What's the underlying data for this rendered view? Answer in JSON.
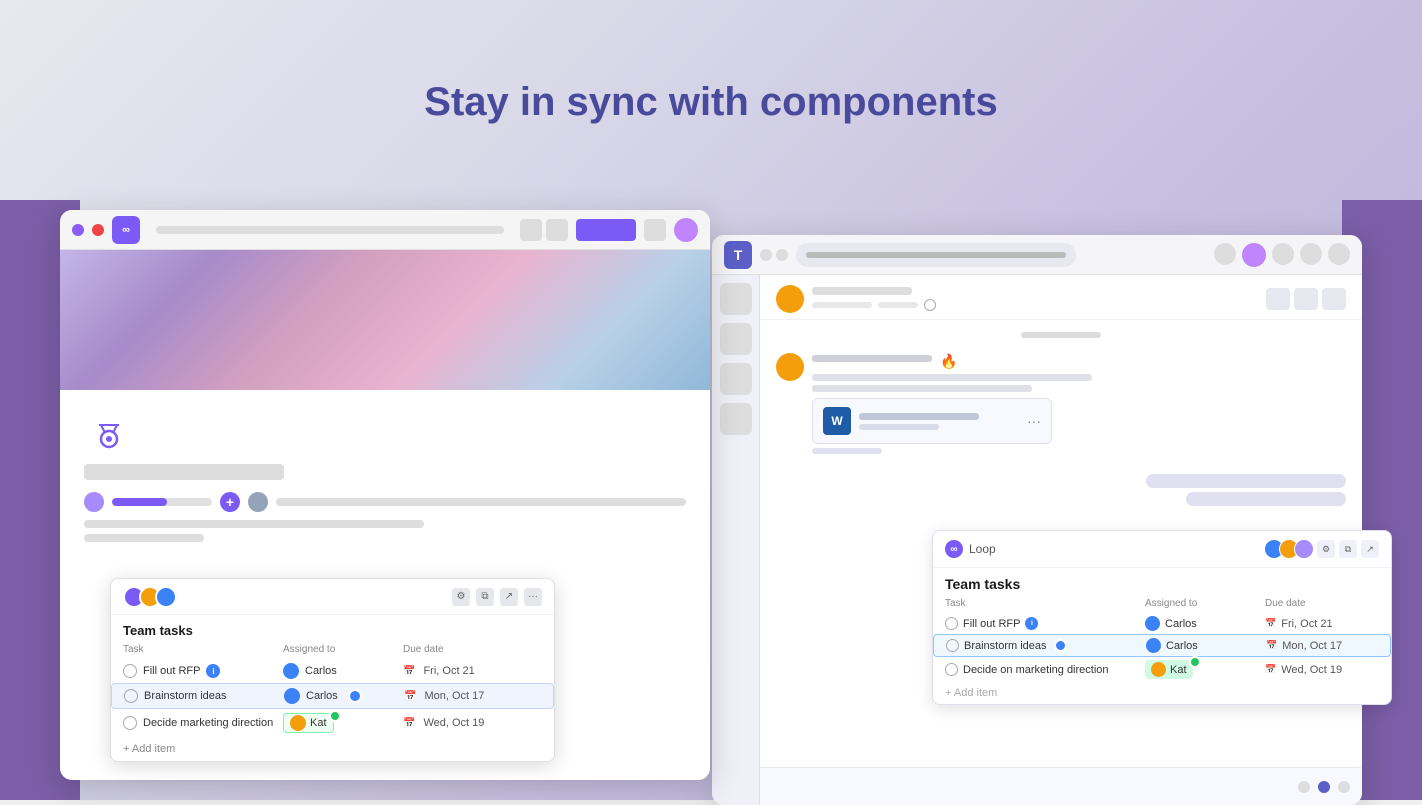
{
  "page": {
    "title": "Stay in sync with components",
    "background_color": "#e8e8f0"
  },
  "left_window": {
    "team_tasks_title": "Team tasks",
    "task_table": {
      "columns": [
        "Task",
        "Assigned to",
        "Due date"
      ],
      "rows": [
        {
          "task": "Fill out RFP",
          "assigned_to": "Carlos",
          "due_date": "Fri, Oct 21",
          "has_badge": true,
          "highlighted": false
        },
        {
          "task": "Brainstorm ideas",
          "assigned_to": "Carlos",
          "due_date": "Mon, Oct 17",
          "has_badge": false,
          "highlighted": true
        },
        {
          "task": "Decide marketing direction",
          "assigned_to": "Kat",
          "due_date": "Wed, Oct 19",
          "has_badge": false,
          "highlighted": false
        }
      ],
      "add_item_label": "+ Add item"
    }
  },
  "right_window": {
    "loop_card": {
      "app_name": "Loop",
      "title": "Team tasks",
      "columns": [
        "Task",
        "Assigned to",
        "Due date"
      ],
      "rows": [
        {
          "task": "Fill out RFP",
          "assigned_to": "Carlos",
          "due_date": "Fri, Oct 21",
          "has_badge": true,
          "highlighted": false
        },
        {
          "task": "Brainstorm ideas",
          "assigned_to": "Carlos",
          "due_date": "Mon, Oct 17",
          "has_badge": false,
          "highlighted": true
        },
        {
          "task": "Decide on marketing direction",
          "assigned_to": "Kat",
          "due_date": "Wed, Oct 19",
          "has_badge": false,
          "highlighted": false
        }
      ],
      "add_item_label": "+ Add item"
    }
  },
  "icons": {
    "loop": "∞",
    "word": "W",
    "teams": "T",
    "close": "×",
    "more": "···",
    "copy": "⧉",
    "share": "↗",
    "settings": "⚙",
    "plus": "+",
    "calendar": "📅"
  }
}
